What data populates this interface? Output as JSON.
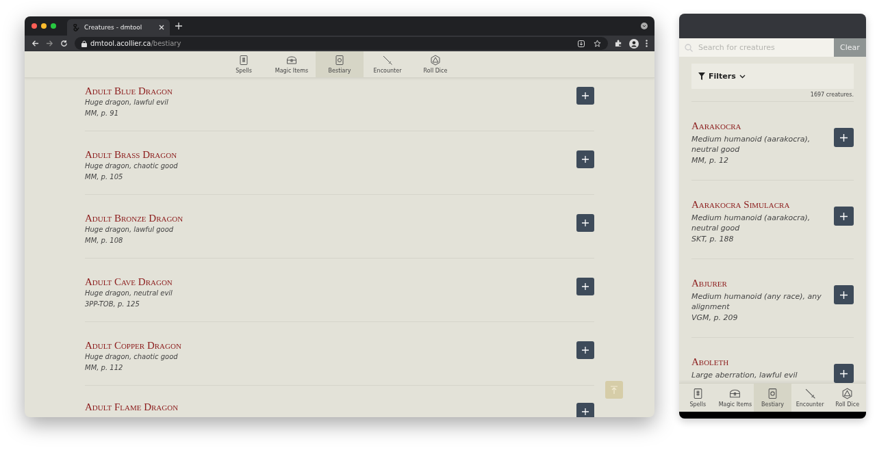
{
  "browser": {
    "tab_title": "Creatures - dmtool",
    "url_host": "dmtool.acollier.ca",
    "url_path": "/bestiary"
  },
  "nav": [
    {
      "label": "Spells",
      "selected": false
    },
    {
      "label": "Magic Items",
      "selected": false
    },
    {
      "label": "Bestiary",
      "selected": true
    },
    {
      "label": "Encounter",
      "selected": false
    },
    {
      "label": "Roll Dice",
      "selected": false
    }
  ],
  "creatures": [
    {
      "name": "Adult Blue Dragon",
      "type": "Huge dragon, lawful evil",
      "source": "MM, p. 91"
    },
    {
      "name": "Adult Brass Dragon",
      "type": "Huge dragon, chaotic good",
      "source": "MM, p. 105"
    },
    {
      "name": "Adult Bronze Dragon",
      "type": "Huge dragon, lawful good",
      "source": "MM, p. 108"
    },
    {
      "name": "Adult Cave Dragon",
      "type": "Huge dragon, neutral evil",
      "source": "3PP-TOB, p. 125"
    },
    {
      "name": "Adult Copper Dragon",
      "type": "Huge dragon, chaotic good",
      "source": "MM, p. 112"
    },
    {
      "name": "Adult Flame Dragon"
    }
  ],
  "mobile": {
    "search": {
      "placeholder": "Search for creatures"
    },
    "clear_button": "Clear",
    "filters_label": "Filters",
    "count": "1697 creatures.",
    "creatures": [
      {
        "name": "Aarakocra",
        "type": "Medium humanoid (aarakocra), neutral good",
        "source": "MM, p. 12"
      },
      {
        "name": "Aarakocra Simulacra",
        "type": "Medium humanoid (aarakocra), neutral good",
        "source": "SKT, p. 188"
      },
      {
        "name": "Abjurer",
        "type": "Medium humanoid (any race), any alignment",
        "source": "VGM, p. 209"
      },
      {
        "name": "Aboleth",
        "type": "Large aberration, lawful evil"
      }
    ],
    "nav": [
      {
        "label": "Spells",
        "selected": false
      },
      {
        "label": "Magic Items",
        "selected": false
      },
      {
        "label": "Bestiary",
        "selected": true
      },
      {
        "label": "Encounter",
        "selected": false
      },
      {
        "label": "Roll Dice",
        "selected": false
      }
    ]
  }
}
